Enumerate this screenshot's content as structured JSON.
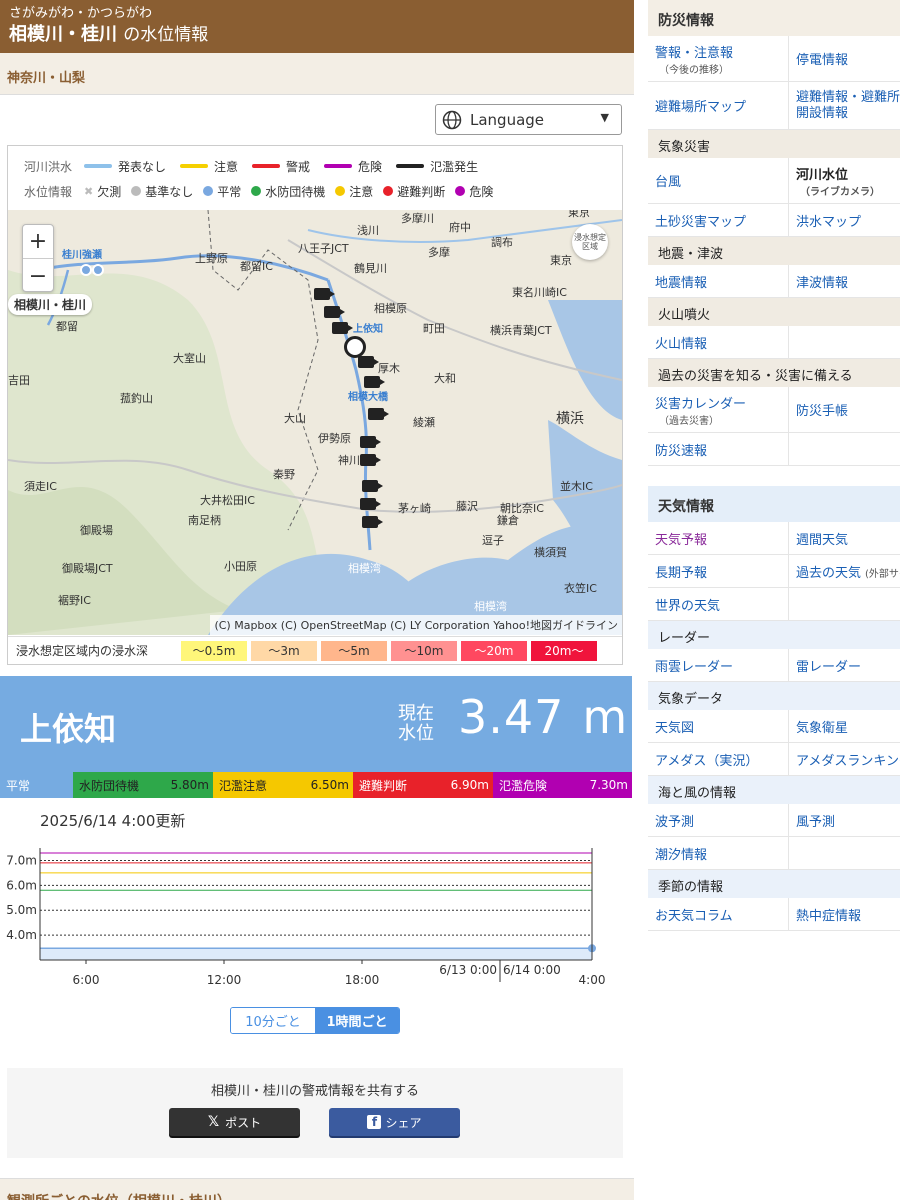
{
  "header": {
    "subtitle": "さがみがわ・かつらがわ",
    "title": "相模川・桂川",
    "title_suffix": "の水位情報"
  },
  "region": "神奈川・山梨",
  "language": {
    "label": "Language"
  },
  "legend": {
    "flood": {
      "label": "河川洪水",
      "items": [
        {
          "label": "発表なし",
          "color": "#8ec1ea"
        },
        {
          "label": "注意",
          "color": "#f5d000"
        },
        {
          "label": "警戒",
          "color": "#e8222a"
        },
        {
          "label": "危険",
          "color": "#b100b1"
        },
        {
          "label": "氾濫発生",
          "color": "#222222"
        }
      ]
    },
    "level": {
      "label": "水位情報",
      "items": [
        {
          "label": "欠測",
          "color": "#bbbbbb",
          "icon": "x-mark-icon"
        },
        {
          "label": "基準なし",
          "color": "#bbbbbb"
        },
        {
          "label": "平常",
          "color": "#7aa8e0"
        },
        {
          "label": "水防団待機",
          "color": "#2ea84a"
        },
        {
          "label": "注意",
          "color": "#f5c800"
        },
        {
          "label": "避難判断",
          "color": "#e8222a"
        },
        {
          "label": "危険",
          "color": "#b100b1"
        }
      ]
    }
  },
  "map": {
    "labels": [
      "東京",
      "浅川",
      "多摩川",
      "府中",
      "八王子JCT",
      "多摩",
      "調布",
      "上野原",
      "都留IC",
      "鶴見川",
      "東京",
      "東名川崎IC",
      "相模原",
      "町田",
      "横浜青葉JCT",
      "大室山",
      "上依知",
      "厚木",
      "横浜",
      "大和",
      "吉田",
      "菰釣山",
      "大山",
      "相模大橋",
      "綾瀬",
      "伊勢原",
      "神川橋",
      "須走IC",
      "秦野",
      "並木IC",
      "大井松田IC",
      "茅ヶ崎",
      "藤沢",
      "朝比奈IC",
      "御殿場",
      "南足柄",
      "鎌倉",
      "逗子",
      "横須賀",
      "御殿場JCT",
      "小田原",
      "相模湾",
      "衣笠IC",
      "裾野IC",
      "相模湾",
      "桂川強瀬",
      "都留"
    ],
    "station_tag": "相模川・桂川",
    "flood_toggle": "浸水想定区域",
    "attribution": "(C) Mapbox (C) OpenStreetMap (C) LY Corporation Yahoo!地図ガイドライン",
    "zoom_in": "+",
    "zoom_out": "−"
  },
  "depth_legend": {
    "label": "浸水想定区域内の浸水深",
    "items": [
      {
        "label": "〜0.5m",
        "color": "#fff67a"
      },
      {
        "label": "〜3m",
        "color": "#ffd8a6"
      },
      {
        "label": "〜5m",
        "color": "#ffb68c"
      },
      {
        "label": "〜10m",
        "color": "#ff9191"
      },
      {
        "label": "〜20m",
        "color": "#ff4860"
      },
      {
        "label": "20m〜",
        "color": "#f0143c"
      }
    ]
  },
  "station": {
    "name": "上依知",
    "current_label": "現在水位",
    "level": "3.47",
    "unit": "m"
  },
  "thresholds": [
    {
      "label": "平常",
      "value": "",
      "color": "#76abe1"
    },
    {
      "label": "水防団待機",
      "value": "5.80m",
      "color": "#2ea84a"
    },
    {
      "label": "氾濫注意",
      "value": "6.50m",
      "color": "#f5c800"
    },
    {
      "label": "避難判断",
      "value": "6.90m",
      "color": "#e8222a"
    },
    {
      "label": "氾濫危険",
      "value": "7.30m",
      "color": "#b100b1"
    }
  ],
  "updated": "2025/6/14 4:00更新",
  "chart_data": {
    "type": "line",
    "title": "",
    "xlabel": "",
    "ylabel": "",
    "ylim": [
      3.0,
      7.5
    ],
    "yticks": [
      "7.0m",
      "6.0m",
      "5.0m",
      "4.0m"
    ],
    "ytick_values": [
      7.0,
      6.0,
      5.0,
      4.0
    ],
    "xticks": [
      "6:00",
      "12:00",
      "18:00",
      "6/13 0:00",
      "6/14 0:00",
      "4:00"
    ],
    "x": [
      "2025-06-13 04:00",
      "2025-06-14 04:00"
    ],
    "series": [
      {
        "values": [
          3.47,
          3.47
        ]
      }
    ],
    "threshold_lines": [
      {
        "value": 7.3,
        "color": "#b100b1"
      },
      {
        "value": 6.9,
        "color": "#e8222a"
      },
      {
        "value": 6.5,
        "color": "#f5c800"
      },
      {
        "value": 5.8,
        "color": "#2ea84a"
      }
    ]
  },
  "interval": {
    "option1": "10分ごと",
    "option2": "1時間ごと",
    "selected": "1時間ごと"
  },
  "share": {
    "label": "相模川・桂川の警戒情報を共有する",
    "x": "ポスト",
    "facebook": "シェア"
  },
  "bottom_title": "観測所ごとの水位（相模川・桂川）",
  "sidebar": {
    "bousai": {
      "title": "防災情報",
      "rows": [
        {
          "left": "警報・注意報",
          "left_sub": "（今後の推移）",
          "right": "停電情報"
        },
        {
          "left": "避難場所マップ",
          "right": "避難情報・避難所開設情報"
        }
      ],
      "groups": [
        {
          "title": "気象災害",
          "rows": [
            {
              "left": "台風",
              "right": "河川水位",
              "right_sub": "（ライブカメラ）"
            },
            {
              "left": "土砂災害マップ",
              "right": "洪水マップ"
            }
          ]
        },
        {
          "title": "地震・津波",
          "rows": [
            {
              "left": "地震情報",
              "right": "津波情報"
            }
          ]
        },
        {
          "title": "火山噴火",
          "rows": [
            {
              "left": "火山情報",
              "right": ""
            }
          ]
        },
        {
          "title": "過去の災害を知る・災害に備える",
          "rows": [
            {
              "left": "災害カレンダー",
              "left_sub": "（過去災害）",
              "right": "防災手帳"
            },
            {
              "left": "防災速報",
              "right": ""
            }
          ]
        }
      ]
    },
    "tenki": {
      "title": "天気情報",
      "rows": [
        {
          "left": "天気予報",
          "right": "週間天気"
        },
        {
          "left": "長期予報",
          "right": "過去の天気",
          "right_sub": "(外部サイト)"
        },
        {
          "left": "世界の天気",
          "right": ""
        }
      ],
      "groups": [
        {
          "title": "レーダー",
          "rows": [
            {
              "left": "雨雲レーダー",
              "right": "雷レーダー"
            }
          ]
        },
        {
          "title": "気象データ",
          "rows": [
            {
              "left": "天気図",
              "right": "気象衛星"
            },
            {
              "left": "アメダス（実況）",
              "right": "アメダスランキング"
            }
          ]
        },
        {
          "title": "海と風の情報",
          "rows": [
            {
              "left": "波予測",
              "right": "風予測"
            },
            {
              "left": "潮汐情報",
              "right": ""
            }
          ]
        },
        {
          "title": "季節の情報",
          "rows": [
            {
              "left": "お天気コラム",
              "right": "熱中症情報"
            }
          ]
        }
      ]
    }
  }
}
